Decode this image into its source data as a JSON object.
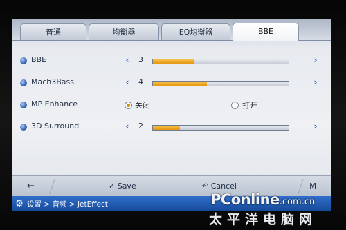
{
  "tabs": [
    {
      "label": "普通",
      "active": false
    },
    {
      "label": "均衡器",
      "active": false
    },
    {
      "label": "EQ均衡器",
      "active": false
    },
    {
      "label": "BBE",
      "active": true
    }
  ],
  "settings": {
    "bbe": {
      "label": "BBE",
      "value": "3",
      "level": 0.3
    },
    "mach3bass": {
      "label": "Mach3Bass",
      "value": "4",
      "level": 0.4
    },
    "mp_enhance": {
      "label": "MP Enhance",
      "option_off": "关闭",
      "option_on": "打开",
      "selected": "关闭"
    },
    "surround": {
      "label": "3D Surround",
      "value": "2",
      "level": 0.2
    }
  },
  "toolbar": {
    "back_label": "←",
    "save_label": "✓ Save",
    "cancel_label": "↶ Cancel",
    "menu_label": "M"
  },
  "statusbar": {
    "breadcrumb": "设置 > 音频 > JetEffect"
  },
  "watermark": {
    "brand": "PConline",
    "domain": ".com.cn",
    "cn": "太平洋电脑网"
  },
  "colors": {
    "accent_blue": "#1d5fb8",
    "slider_fill": "#e59612",
    "statusbar": "#1f57a8"
  },
  "icons": {
    "row_bullet": "dot-icon",
    "arrow_left": "chevron-left-icon",
    "arrow_right": "chevron-right-icon",
    "gear": "gear-icon"
  }
}
